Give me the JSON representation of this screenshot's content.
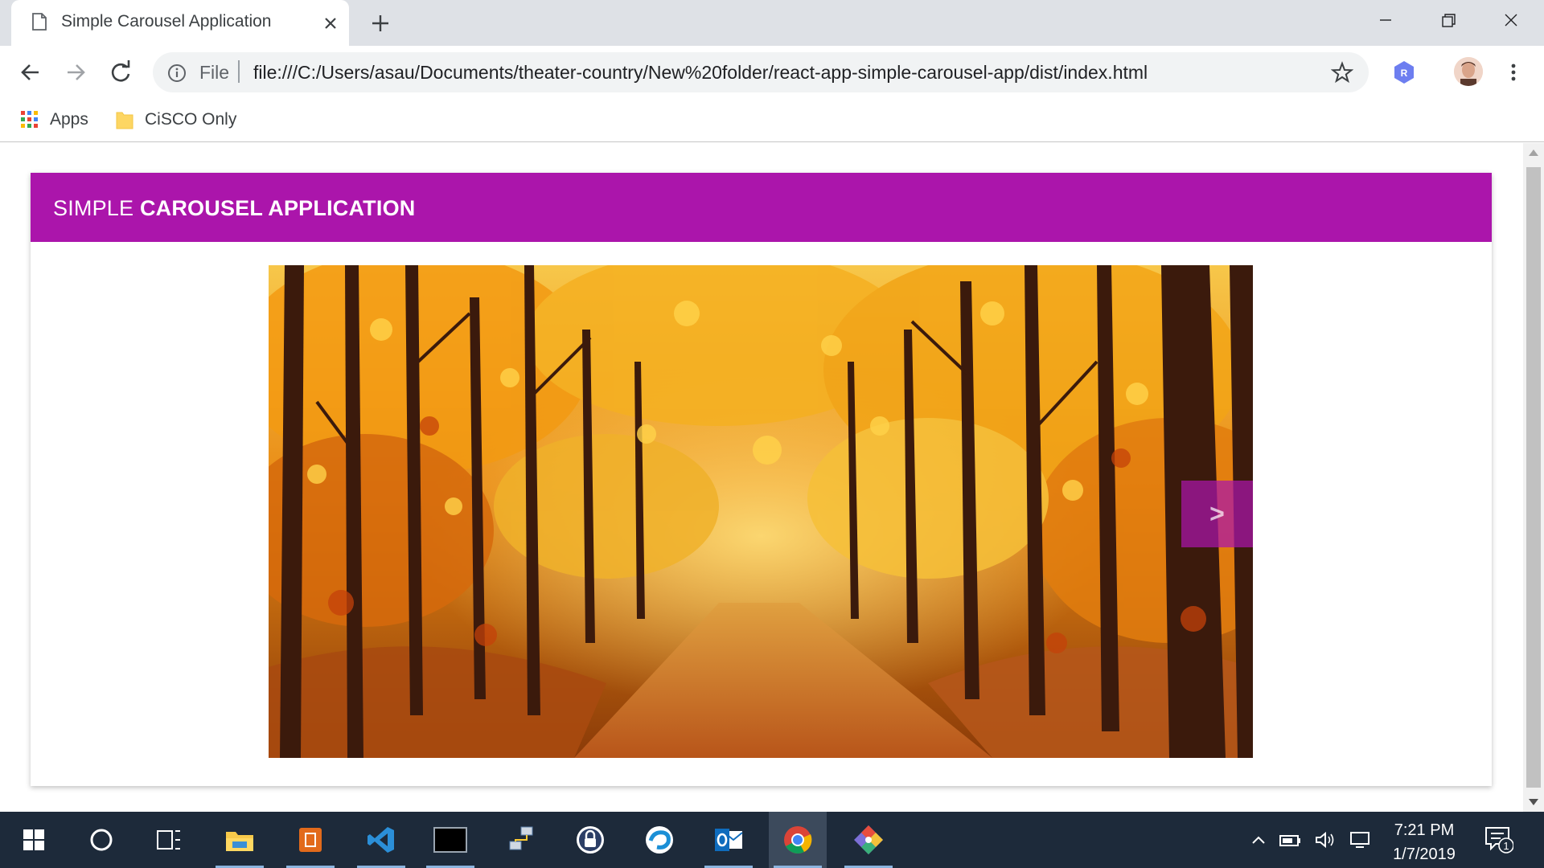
{
  "browser": {
    "tab_title": "Simple Carousel Application",
    "scheme_label": "File",
    "url": "file:///C:/Users/asau/Documents/theater-country/New%20folder/react-app-simple-carousel-app/dist/index.html",
    "extension_badge": "R"
  },
  "bookmarks": {
    "items": [
      {
        "label": "Apps",
        "icon": "apps-grid-icon"
      },
      {
        "label": "CiSCO Only",
        "icon": "folder-icon"
      }
    ]
  },
  "app": {
    "title_light": "SIMPLE",
    "title_bold": "CAROUSEL APPLICATION",
    "header_color": "#ab15ab",
    "carousel": {
      "current_slide": "autumn-forest-path",
      "next_label": ">"
    }
  },
  "taskbar": {
    "apps": [
      {
        "name": "start-icon"
      },
      {
        "name": "cortana-icon"
      },
      {
        "name": "task-view-icon"
      },
      {
        "name": "file-explorer-icon"
      },
      {
        "name": "powerpoint-icon"
      },
      {
        "name": "vscode-icon"
      },
      {
        "name": "terminal-icon"
      },
      {
        "name": "network-icon"
      },
      {
        "name": "vpn-lock-icon"
      },
      {
        "name": "webex-icon"
      },
      {
        "name": "outlook-icon"
      },
      {
        "name": "chrome-icon"
      },
      {
        "name": "git-icon"
      }
    ],
    "time": "7:21 PM",
    "date": "1/7/2019",
    "notification_count": "1"
  }
}
